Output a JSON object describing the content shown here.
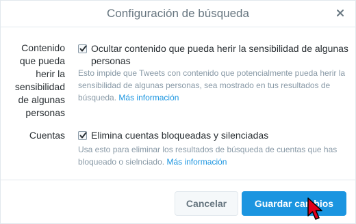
{
  "dialog": {
    "title": "Configuración de búsqueda"
  },
  "sections": [
    {
      "label": "Contenido que pueda herir la sensibilidad de algunas personas",
      "checkbox_label": "Ocultar contenido que pueda herir la sensibilidad de algunas personas",
      "checked": true,
      "help_text": "Esto impide que Tweets con contenido que potencialmente pueda herir la sensibilidad de algunas personas, sea mostrado en tus resultados de búsqueda.",
      "help_link": "Más información"
    },
    {
      "label": "Cuentas",
      "checkbox_label": "Elimina cuentas bloqueadas y silenciadas",
      "checked": true,
      "help_text": "Usa esto para eliminar los resultados de búsqueda de cuentas que has bloqueado o sielnciado.",
      "help_link": "Más información"
    }
  ],
  "buttons": {
    "cancel": "Cancelar",
    "save": "Guardar cambios"
  },
  "icons": {
    "close": "close-icon",
    "checkmark": "checkmark-icon",
    "cursor": "mouse-pointer-icon"
  },
  "colors": {
    "accent": "#1b95e0",
    "cursor": "#e0001b"
  }
}
